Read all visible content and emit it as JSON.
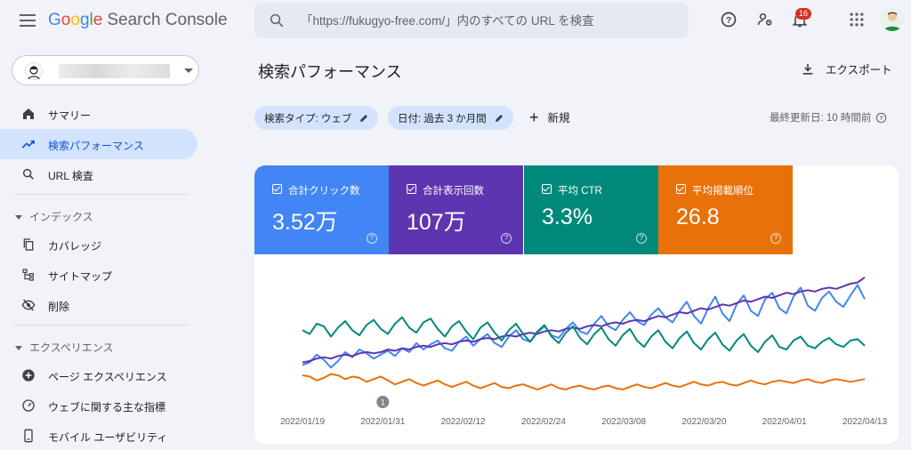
{
  "app": {
    "logo_letters": [
      "G",
      "o",
      "o",
      "g",
      "l",
      "e"
    ],
    "product": "Search Console"
  },
  "search": {
    "placeholder": "「https://fukugyo-free.com/」内のすべての URL を検査"
  },
  "header": {
    "notification_count": "16"
  },
  "property": {
    "selector_label": ""
  },
  "sidebar": {
    "items_top": [
      {
        "label": "サマリー",
        "icon": "home-icon"
      },
      {
        "label": "検索パフォーマンス",
        "icon": "trending-up-icon",
        "active": true
      },
      {
        "label": "URL 検査",
        "icon": "search-icon"
      }
    ],
    "sections": [
      {
        "label": "インデックス",
        "items": [
          {
            "label": "カバレッジ",
            "icon": "copy-icon"
          },
          {
            "label": "サイトマップ",
            "icon": "sitemap-icon"
          },
          {
            "label": "削除",
            "icon": "eye-off-icon"
          }
        ]
      },
      {
        "label": "エクスペリエンス",
        "items": [
          {
            "label": "ページ エクスペリエンス",
            "icon": "plus-circle-icon"
          },
          {
            "label": "ウェブに関する主な指標",
            "icon": "gauge-icon"
          },
          {
            "label": "モバイル ユーザビリティ",
            "icon": "phone-icon"
          }
        ]
      }
    ]
  },
  "main": {
    "title": "検索パフォーマンス",
    "export_label": "エクスポート",
    "filters": [
      {
        "label": "検索タイプ: ウェブ"
      },
      {
        "label": "日付: 過去 3 か月間"
      }
    ],
    "new_label": "新規",
    "last_updated": "最終更新日: 10 時間前"
  },
  "metrics": [
    {
      "label": "合計クリック数",
      "value": "3.52万",
      "color": "#4285f4"
    },
    {
      "label": "合計表示回数",
      "value": "107万",
      "color": "#5e35b1"
    },
    {
      "label": "平均 CTR",
      "value": "3.3%",
      "color": "#00897b"
    },
    {
      "label": "平均掲載順位",
      "value": "26.8",
      "color": "#e8710a"
    }
  ],
  "chart_data": {
    "type": "line",
    "x_tick_labels": [
      "2022/01/19",
      "2022/01/31",
      "2022/02/12",
      "2022/02/24",
      "2022/03/08",
      "2022/03/20",
      "2022/04/01",
      "2022/04/13"
    ],
    "annotation": {
      "label": "1",
      "date": "2022/01/31"
    },
    "normalized": true,
    "series": [
      {
        "color": "#4285f4",
        "values": [
          0.28,
          0.3,
          0.36,
          0.32,
          0.26,
          0.31,
          0.38,
          0.34,
          0.4,
          0.37,
          0.33,
          0.36,
          0.39,
          0.35,
          0.41,
          0.38,
          0.45,
          0.4,
          0.44,
          0.47,
          0.41,
          0.39,
          0.46,
          0.5,
          0.43,
          0.48,
          0.52,
          0.45,
          0.42,
          0.5,
          0.55,
          0.48,
          0.46,
          0.53,
          0.58,
          0.51,
          0.49,
          0.56,
          0.61,
          0.54,
          0.52,
          0.6,
          0.66,
          0.58,
          0.55,
          0.63,
          0.69,
          0.62,
          0.59,
          0.67,
          0.72,
          0.65,
          0.61,
          0.7,
          0.77,
          0.66,
          0.6,
          0.72,
          0.81,
          0.68,
          0.62,
          0.75,
          0.82,
          0.7,
          0.66,
          0.79,
          0.84,
          0.72,
          0.68,
          0.81,
          0.88,
          0.74,
          0.7,
          0.8,
          0.85,
          0.77,
          0.73,
          0.82,
          0.9,
          0.79
        ]
      },
      {
        "color": "#5e35b1",
        "values": [
          0.3,
          0.31,
          0.33,
          0.34,
          0.33,
          0.35,
          0.36,
          0.35,
          0.37,
          0.38,
          0.37,
          0.38,
          0.4,
          0.39,
          0.41,
          0.4,
          0.42,
          0.43,
          0.42,
          0.44,
          0.45,
          0.44,
          0.46,
          0.47,
          0.46,
          0.48,
          0.49,
          0.48,
          0.5,
          0.51,
          0.5,
          0.52,
          0.53,
          0.52,
          0.54,
          0.55,
          0.54,
          0.56,
          0.57,
          0.56,
          0.58,
          0.59,
          0.58,
          0.6,
          0.61,
          0.6,
          0.62,
          0.63,
          0.62,
          0.64,
          0.66,
          0.65,
          0.67,
          0.69,
          0.68,
          0.7,
          0.72,
          0.71,
          0.73,
          0.75,
          0.74,
          0.76,
          0.78,
          0.77,
          0.79,
          0.81,
          0.8,
          0.82,
          0.84,
          0.83,
          0.85,
          0.86,
          0.85,
          0.87,
          0.88,
          0.87,
          0.89,
          0.91,
          0.92,
          0.96
        ]
      },
      {
        "color": "#00897b",
        "values": [
          0.55,
          0.52,
          0.6,
          0.58,
          0.5,
          0.57,
          0.62,
          0.55,
          0.51,
          0.59,
          0.63,
          0.56,
          0.52,
          0.6,
          0.65,
          0.57,
          0.53,
          0.61,
          0.64,
          0.56,
          0.5,
          0.58,
          0.62,
          0.54,
          0.48,
          0.57,
          0.61,
          0.53,
          0.47,
          0.55,
          0.6,
          0.52,
          0.46,
          0.54,
          0.59,
          0.5,
          0.45,
          0.53,
          0.58,
          0.49,
          0.44,
          0.52,
          0.57,
          0.48,
          0.43,
          0.51,
          0.56,
          0.47,
          0.42,
          0.5,
          0.55,
          0.46,
          0.41,
          0.49,
          0.54,
          0.45,
          0.4,
          0.48,
          0.53,
          0.44,
          0.39,
          0.47,
          0.52,
          0.43,
          0.38,
          0.46,
          0.51,
          0.42,
          0.4,
          0.47,
          0.5,
          0.43,
          0.41,
          0.46,
          0.49,
          0.44,
          0.42,
          0.47,
          0.48,
          0.43
        ]
      },
      {
        "color": "#e8710a",
        "values": [
          0.2,
          0.19,
          0.16,
          0.18,
          0.21,
          0.2,
          0.17,
          0.19,
          0.18,
          0.15,
          0.17,
          0.19,
          0.16,
          0.13,
          0.15,
          0.17,
          0.14,
          0.12,
          0.14,
          0.16,
          0.13,
          0.11,
          0.13,
          0.15,
          0.12,
          0.1,
          0.12,
          0.14,
          0.11,
          0.1,
          0.12,
          0.13,
          0.11,
          0.09,
          0.11,
          0.13,
          0.1,
          0.09,
          0.11,
          0.12,
          0.1,
          0.09,
          0.11,
          0.12,
          0.1,
          0.09,
          0.11,
          0.13,
          0.11,
          0.1,
          0.12,
          0.14,
          0.12,
          0.11,
          0.13,
          0.15,
          0.13,
          0.12,
          0.14,
          0.15,
          0.13,
          0.12,
          0.14,
          0.16,
          0.14,
          0.13,
          0.15,
          0.16,
          0.15,
          0.14,
          0.16,
          0.17,
          0.15,
          0.14,
          0.16,
          0.17,
          0.16,
          0.15,
          0.16,
          0.17
        ]
      }
    ]
  }
}
